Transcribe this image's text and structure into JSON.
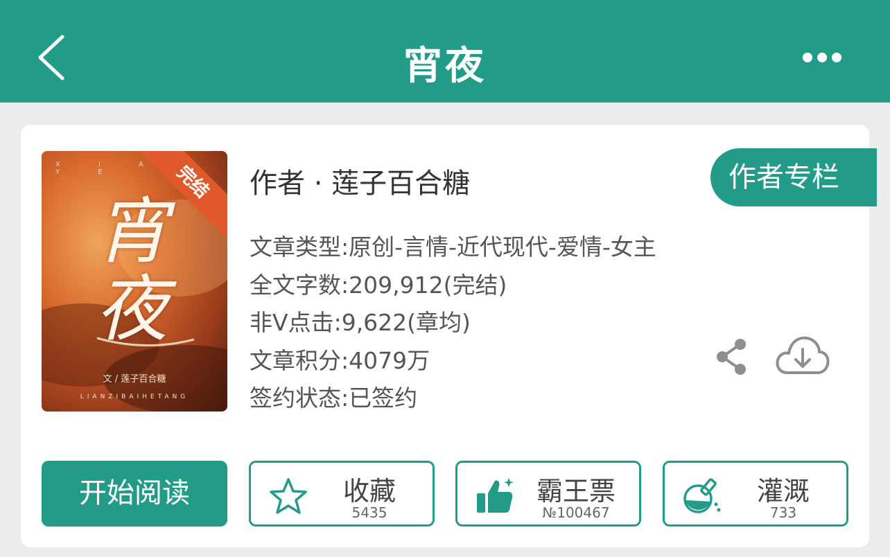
{
  "header": {
    "title": "宵夜",
    "back_icon": "chevron-left-icon",
    "more_icon": "more-dots-icon"
  },
  "book": {
    "cover": {
      "top_text": "X I A O Y E",
      "big_title": "宵夜",
      "byline": "文 / 莲子百合糖",
      "english": "LIANZIBAIHETANG",
      "ribbon": "完结"
    },
    "author_line": "作者 · 莲子百合糖",
    "author_column_button": "作者专栏",
    "meta": [
      "文章类型:原创-言情-近代现代-爱情-女主",
      "全文字数:209,912(完结)",
      "非V点击:9,622(章均)",
      "文章积分:4079万",
      "签约状态:已签约"
    ]
  },
  "actions": {
    "read_label": "开始阅读",
    "favorite": {
      "label": "收藏",
      "count": "5435",
      "icon": "star-icon"
    },
    "vote": {
      "label": "霸王票",
      "count": "№100467",
      "icon": "thumbs-up-icon"
    },
    "water": {
      "label": "灌溉",
      "count": "733",
      "icon": "flask-icon"
    }
  },
  "icons": {
    "share": "share-icon",
    "download": "cloud-download-icon"
  },
  "colors": {
    "brand": "#239b89",
    "ribbon": "#e0592b"
  }
}
